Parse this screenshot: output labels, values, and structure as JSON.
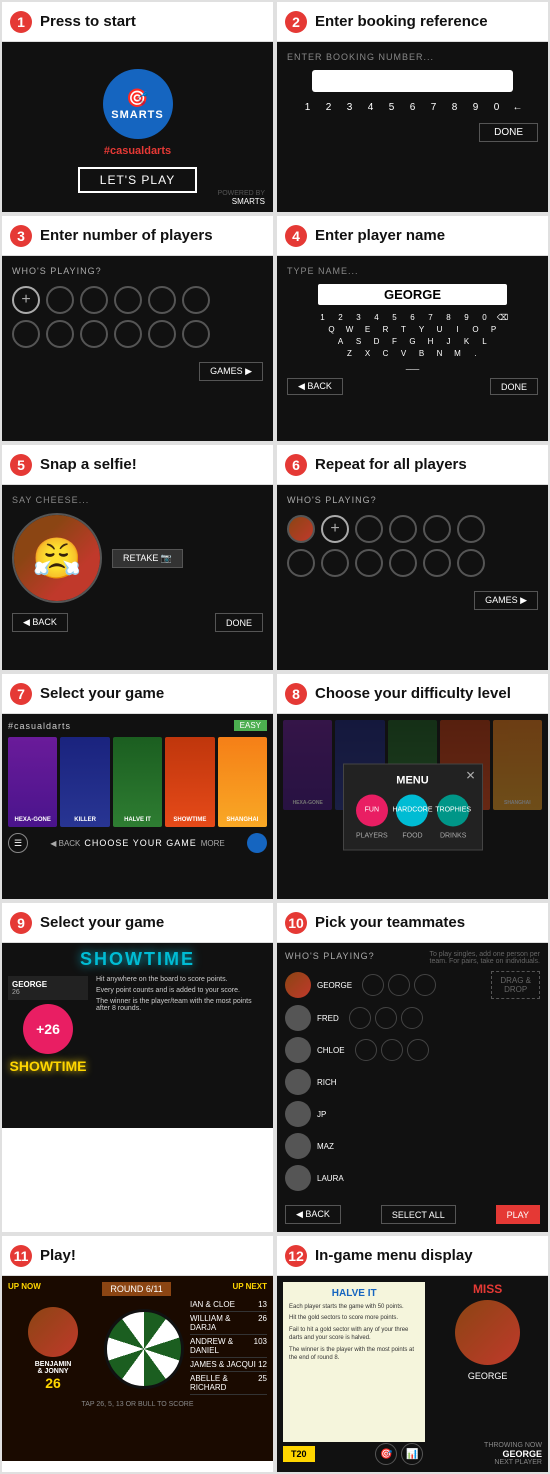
{
  "steps": [
    {
      "num": "1",
      "title": "Press to start"
    },
    {
      "num": "2",
      "title": "Enter booking reference"
    },
    {
      "num": "3",
      "title": "Enter number of players"
    },
    {
      "num": "4",
      "title": "Enter player name"
    },
    {
      "num": "5",
      "title": "Snap a selfie!"
    },
    {
      "num": "6",
      "title": "Repeat for all players"
    },
    {
      "num": "7",
      "title": "Select your game"
    },
    {
      "num": "8",
      "title": "Choose your difficulty level"
    },
    {
      "num": "9",
      "title": "Select your game"
    },
    {
      "num": "10",
      "title": "Pick your teammates"
    },
    {
      "num": "11",
      "title": "Play!"
    },
    {
      "num": "12",
      "title": "In-game menu display"
    }
  ],
  "step1": {
    "logo_text": "SMARTS",
    "hashtag": "#casualdarts",
    "lets_play": "LET'S PLAY",
    "powered_by": "POWERED BY",
    "smarts_small": "SMARTS"
  },
  "step2": {
    "label": "ENTER BOOKING NUMBER...",
    "numpad": [
      "1",
      "2",
      "3",
      "4",
      "5",
      "6",
      "7",
      "8",
      "9",
      "0",
      "←"
    ],
    "done": "DONE"
  },
  "step3": {
    "label": "WHO'S PLAYING?",
    "games": "GAMES ▶"
  },
  "step4": {
    "label": "TYPE NAME...",
    "name": "GEORGE",
    "keys_row1": [
      "1",
      "2",
      "3",
      "4",
      "5",
      "6",
      "7",
      "8",
      "9",
      "0",
      "⌫"
    ],
    "keys_row2": [
      "Q",
      "W",
      "E",
      "R",
      "T",
      "Y",
      "U",
      "I",
      "O",
      "P"
    ],
    "keys_row3": [
      "A",
      "S",
      "D",
      "F",
      "G",
      "H",
      "J",
      "K",
      "L"
    ],
    "keys_row4": [
      "Z",
      "X",
      "C",
      "V",
      "B",
      "N",
      "M",
      "."
    ],
    "back": "◀ BACK",
    "done": "DONE"
  },
  "step5": {
    "label": "SAY CHEESE...",
    "retake": "RETAKE 📷",
    "back": "◀ BACK",
    "done": "DONE"
  },
  "step6": {
    "label": "WHO'S PLAYING?",
    "games": "GAMES ▶"
  },
  "step7": {
    "brand": "#casualdarts",
    "badge": "EASY",
    "games": [
      {
        "name": "HEXA-GONE",
        "class": "gc-hexa"
      },
      {
        "name": "KILLER",
        "class": "gc-killer"
      },
      {
        "name": "HALVE IT",
        "class": "gc-halve"
      },
      {
        "name": "SHOWTIME",
        "class": "gc-showtime"
      },
      {
        "name": "SHANGHAI",
        "class": "gc-shanghai"
      }
    ],
    "back": "◀ BACK",
    "choose": "CHOOSE YOUR GAME",
    "more": "MORE"
  },
  "step8": {
    "menu_title": "MENU",
    "menu_close": "✕",
    "btn1": "FUN",
    "btn2": "HARDCORE",
    "btn3": "TROPHIES",
    "btn4": "PLAYERS",
    "btn5": "FOOD",
    "btn6": "DRINKS"
  },
  "step9": {
    "title": "SHOWTIME",
    "player_name": "GEORGE",
    "player_num": "26",
    "score": "+26",
    "desc1": "Hit anywhere on the board to score points.",
    "desc2": "Every point counts and is added to your score.",
    "desc3": "The winner is the player/team with the most points after 8 rounds."
  },
  "step10": {
    "label": "WHO'S PLAYING?",
    "hint": "To play singles, add one person per team. For pairs, take on individuals.",
    "players": [
      {
        "name": "GEORGE"
      },
      {
        "name": "FRED"
      },
      {
        "name": "CHLOE"
      },
      {
        "name": "RICH"
      },
      {
        "name": "JP"
      },
      {
        "name": "MAZ"
      },
      {
        "name": "LAURA"
      }
    ],
    "drag_drop": "DRAG &\nDROP",
    "back": "◀ BACK",
    "select_all": "SELECT ALL",
    "play": "PLAY"
  },
  "step11": {
    "up_now": "UP NOW",
    "round": "ROUND 6/11",
    "up_next": "UP NEXT",
    "player": "BENJAMIN\n& JONNY",
    "player_score": "26",
    "scores": [
      {
        "name": "IAN & CLOE",
        "score": "13"
      },
      {
        "name": "WILLIAM & DARJA",
        "score": "26"
      },
      {
        "name": "ANDREW & DANIEL",
        "score": "103"
      },
      {
        "name": "JAMES & JACQUI",
        "score": "12"
      },
      {
        "name": "ABELLE & RICHARD",
        "score": "25"
      }
    ],
    "bottom_hint": "TAP 26, 5, 13 OR BULL TO SCORE"
  },
  "step12": {
    "game_title": "HALVE IT",
    "miss": "MISS",
    "rule1": "Each player starts the game with 50 points.",
    "rule2": "Hit the gold sectors to score more points.",
    "rule3": "Fail to hit a gold sector with any of your three darts and your score is halved.",
    "rule4": "The winner is the player with the most points at the end of round 8.",
    "t20": "T20",
    "player_turn": "THROWING NOW",
    "player_name": "GEORGE",
    "next_player": "NEXT PLAYER"
  }
}
